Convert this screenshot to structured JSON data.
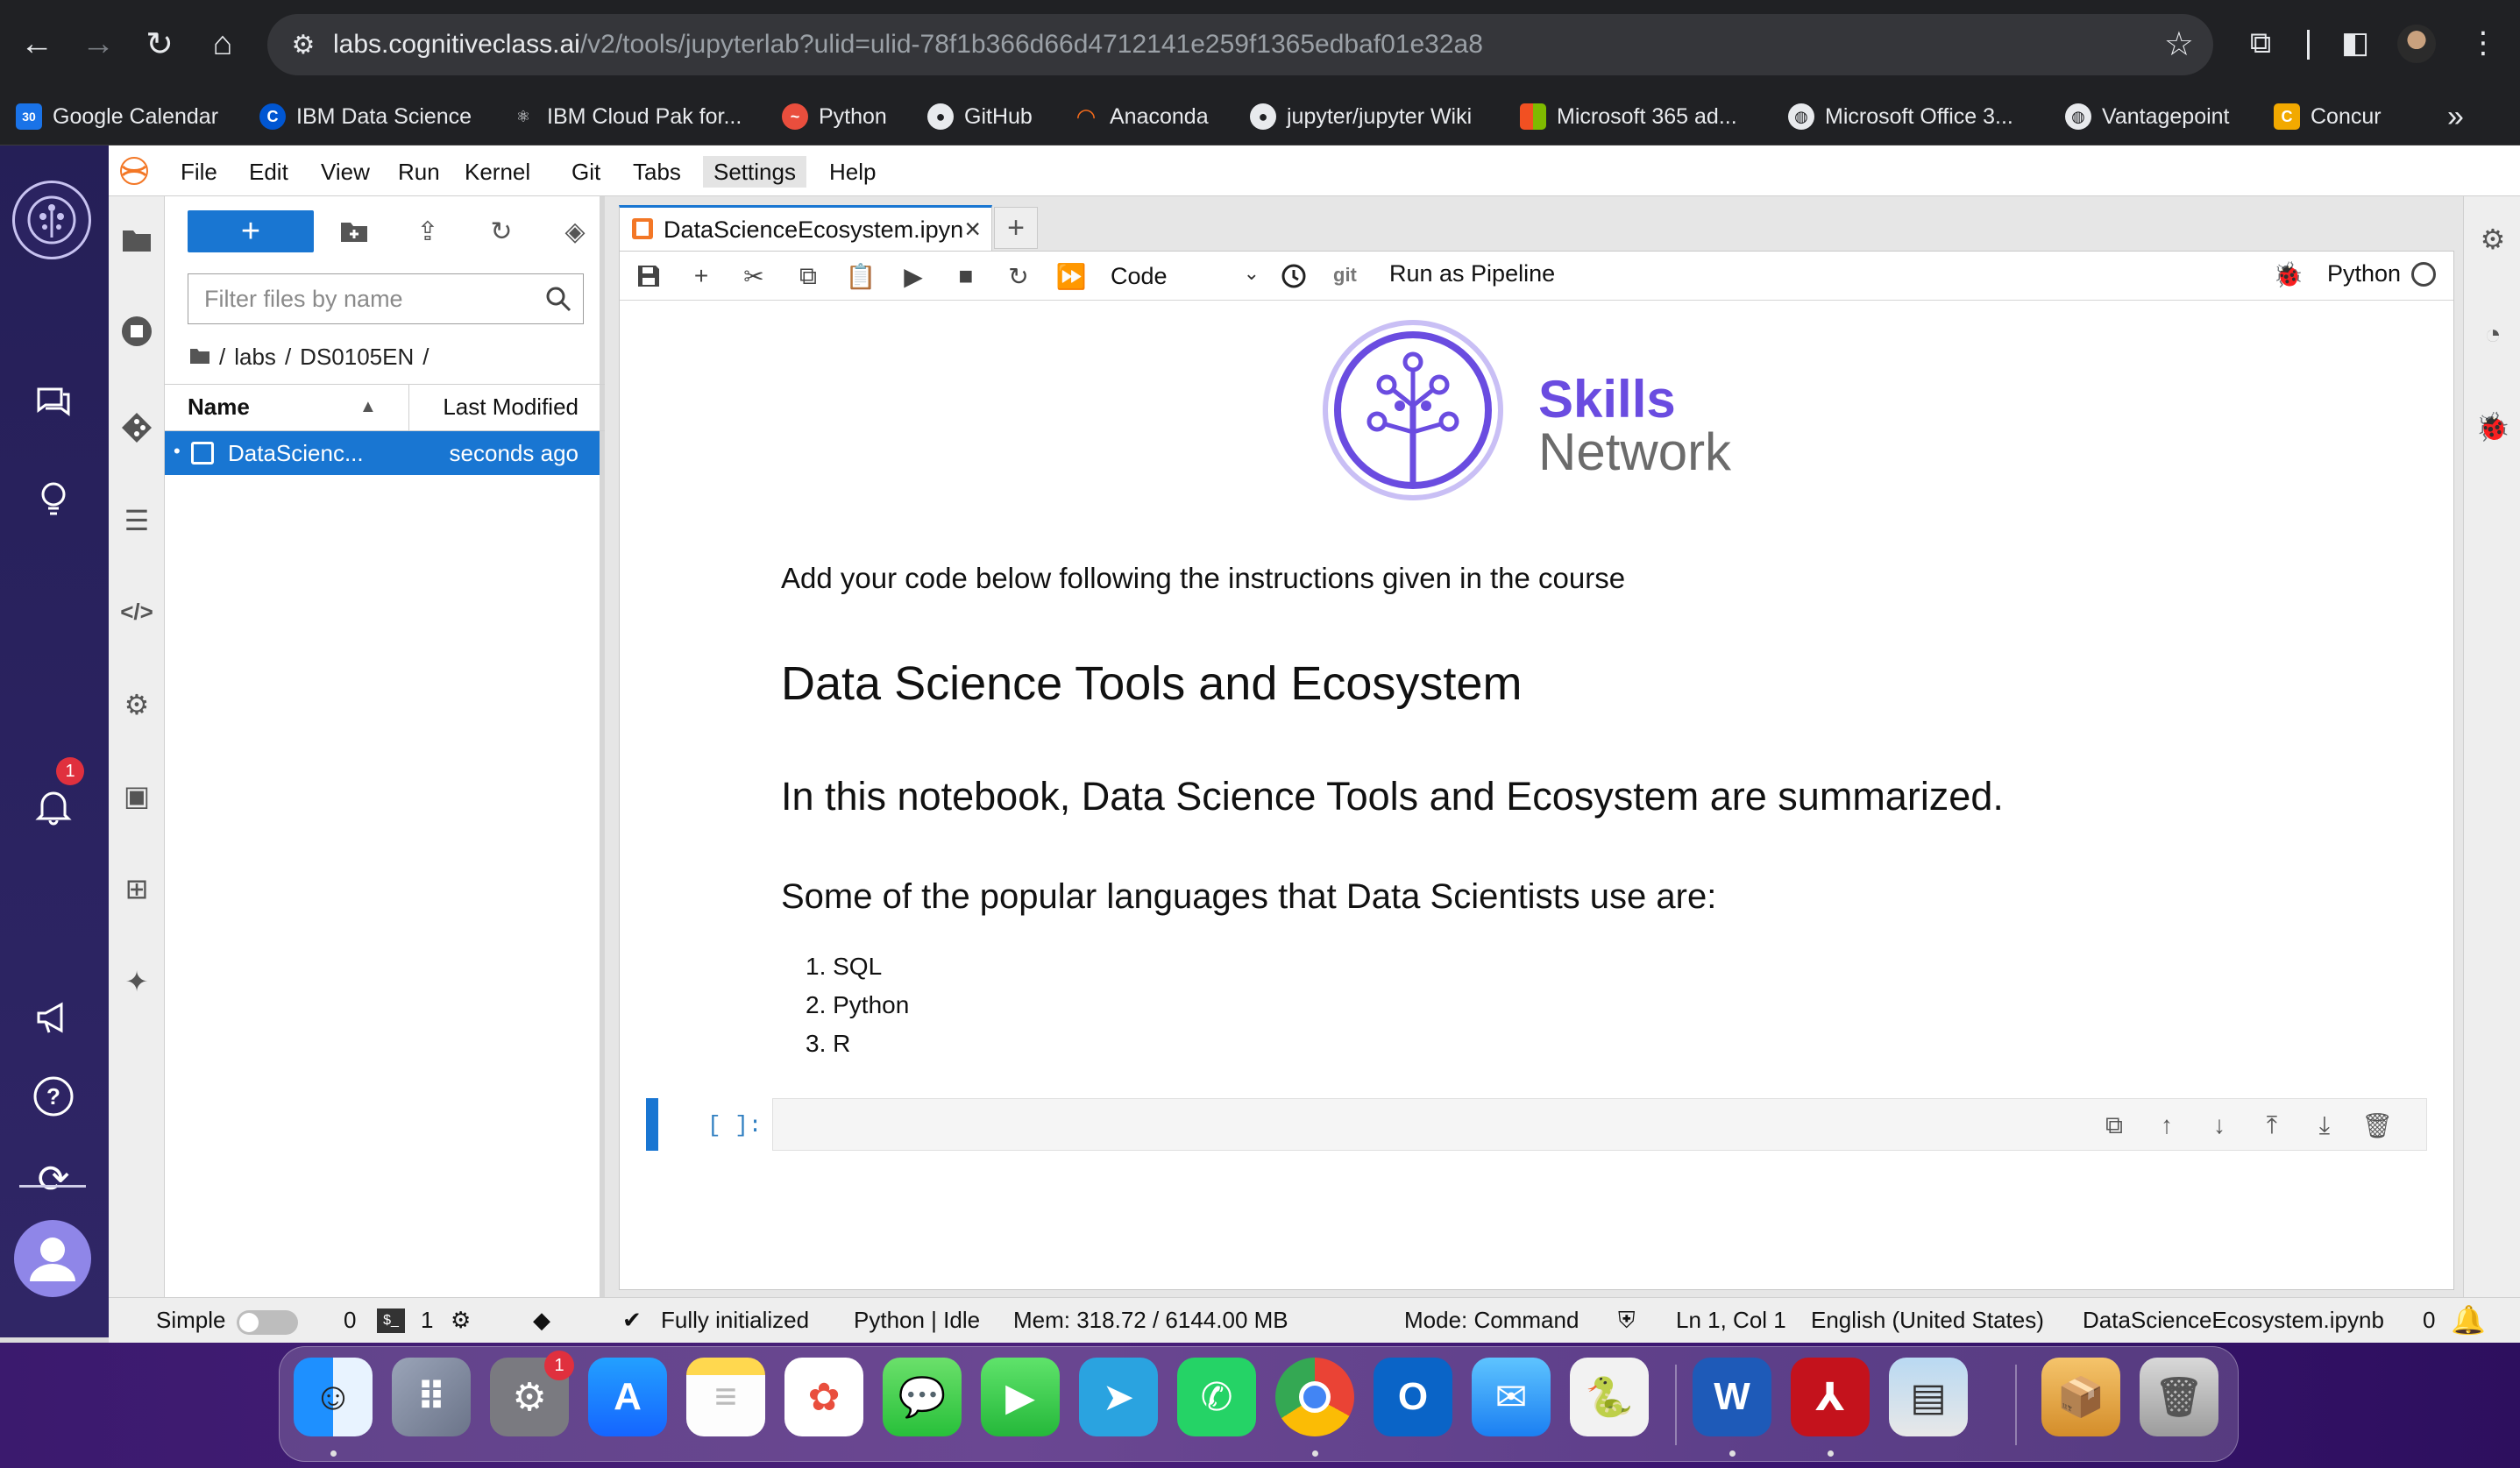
{
  "browser": {
    "url_host": "labs.cognitiveclass.ai",
    "url_path": "/v2/tools/jupyterlab?ulid=ulid-78f1b366d66d4712141e259f1365edbaf01e32a8",
    "bookmarks": [
      {
        "label": "Google Calendar",
        "icon": "calendar-icon",
        "color": "#1a73e8",
        "glyph": "30"
      },
      {
        "label": "IBM Data Science",
        "icon": "coursera-icon",
        "color": "#0056d2",
        "glyph": "C"
      },
      {
        "label": "IBM Cloud Pak for...",
        "icon": "ibm-cloud-icon",
        "color": "#202124",
        "glyph": "⚛"
      },
      {
        "label": "Python",
        "icon": "python-icon",
        "color": "#e94e3d",
        "glyph": "🍣"
      },
      {
        "label": "GitHub",
        "icon": "github-icon",
        "color": "#202124",
        "glyph": "●"
      },
      {
        "label": "Anaconda",
        "icon": "anaconda-icon",
        "color": "#202124",
        "glyph": "◯"
      },
      {
        "label": "jupyter/jupyter Wiki",
        "icon": "github-icon",
        "color": "#202124",
        "glyph": "●"
      },
      {
        "label": "Microsoft 365 ad...",
        "icon": "microsoft-icon",
        "color": "#f25022",
        "glyph": "▦"
      },
      {
        "label": "Microsoft Office 3...",
        "icon": "globe-icon",
        "color": "#202124",
        "glyph": "◍"
      },
      {
        "label": "Vantagepoint",
        "icon": "globe-icon",
        "color": "#202124",
        "glyph": "◍"
      },
      {
        "label": "Concur",
        "icon": "concur-icon",
        "color": "#f2a900",
        "glyph": "C"
      }
    ]
  },
  "menubar": {
    "items": [
      "File",
      "Edit",
      "View",
      "Run",
      "Kernel",
      "Git",
      "Tabs",
      "Settings",
      "Help"
    ],
    "active": "Settings"
  },
  "sidebar": {
    "notifications_count": "1"
  },
  "filebrowser": {
    "new_label": "+",
    "filter_placeholder": "Filter files by name",
    "breadcrumb": [
      "labs",
      "DS0105EN"
    ],
    "columns": {
      "name": "Name",
      "modified": "Last Modified"
    },
    "files": [
      {
        "name": "DataScienc...",
        "modified": "seconds ago"
      }
    ]
  },
  "notebook": {
    "tab_label": "DataScienceEcosystem.ipyn",
    "cell_type": "Code",
    "git_label": "git",
    "pipeline_label": "Run as Pipeline",
    "kernel_name": "Python",
    "banner": {
      "line1": "Skills",
      "line2": "Network"
    },
    "intro": "Add your code below following the instructions given in the course",
    "h1": "Data Science Tools and Ecosystem",
    "h2": "In this notebook, Data Science Tools and Ecosystem are summarized.",
    "h3": "Some of the popular languages that Data Scientists use are:",
    "languages": [
      "1. SQL",
      "2. Python",
      "3. R"
    ],
    "code_prompt": "[ ]:"
  },
  "statusbar": {
    "mode_label": "Simple",
    "terminals": "0",
    "kernels": "1",
    "init": "Fully initialized",
    "kernel_state": "Python | Idle",
    "memory": "Mem: 318.72 / 6144.00 MB",
    "mode": "Mode: Command",
    "cursor": "Ln 1, Col 1",
    "language": "English (United States)",
    "filename": "DataScienceEcosystem.ipynb",
    "notifications": "0"
  },
  "dock": {
    "badges": {
      "settings": "1"
    }
  },
  "colors": {
    "accent": "#1976d2",
    "skills_purple": "#6a4ce0",
    "rail": "#251f57"
  }
}
